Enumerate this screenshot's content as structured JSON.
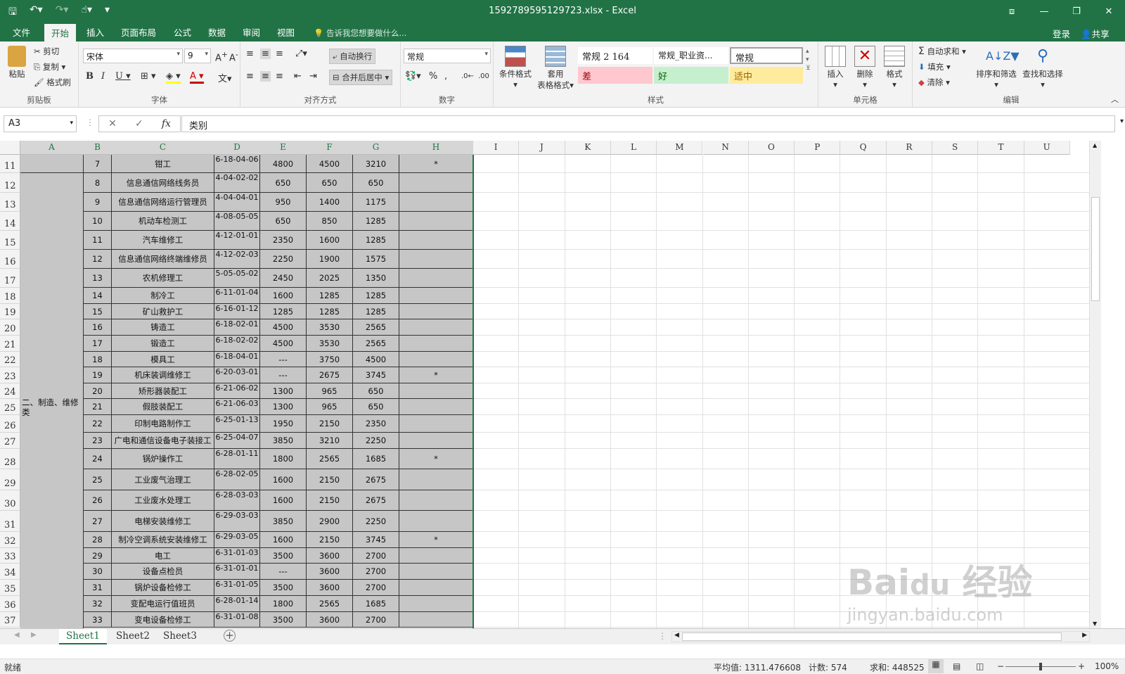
{
  "title": "1592789595129723.xlsx - Excel",
  "tabs": [
    "文件",
    "开始",
    "插入",
    "页面布局",
    "公式",
    "数据",
    "审阅",
    "视图"
  ],
  "tell_me": "告诉我您想要做什么...",
  "signin": "登录",
  "share": "共享",
  "ribbon": {
    "clipboard": {
      "paste": "粘贴",
      "cut": "剪切",
      "copy": "复制",
      "format_painter": "格式刷",
      "label": "剪贴板"
    },
    "font": {
      "name": "宋体",
      "size": "9",
      "label": "字体"
    },
    "align": {
      "wrap": "自动换行",
      "merge": "合并后居中",
      "label": "对齐方式"
    },
    "number": {
      "format": "常规",
      "label": "数字"
    },
    "styles": {
      "cond": "条件格式",
      "table1": "套用",
      "table2": "表格格式",
      "s1": "常规 2 164",
      "s2": "常规_职业资...",
      "s3": "常规",
      "bad": "差",
      "good": "好",
      "neutral": "适中",
      "label": "样式"
    },
    "cells": {
      "insert": "插入",
      "delete": "删除",
      "format": "格式",
      "label": "单元格"
    },
    "editing": {
      "autosum": "自动求和",
      "fill": "填充",
      "clear": "清除",
      "sort": "排序和筛选",
      "find": "查找和选择",
      "label": "编辑"
    }
  },
  "namebox": "A3",
  "formula": "类别",
  "columns": [
    "A",
    "B",
    "C",
    "D",
    "E",
    "F",
    "G",
    "H",
    "I",
    "J",
    "K",
    "L",
    "M",
    "N",
    "O",
    "P",
    "Q",
    "R",
    "S",
    "T",
    "U"
  ],
  "category": "二、制造、维修类",
  "rows": [
    {
      "r": "11",
      "b": "7",
      "c": "钳工",
      "d": "6-18-04-06",
      "e": "4800",
      "f": "4500",
      "g": "3210",
      "h": "*"
    },
    {
      "r": "12",
      "b": "8",
      "c": "信息通信网络线务员",
      "d": "4-04-02-02",
      "e": "650",
      "f": "650",
      "g": "650",
      "h": ""
    },
    {
      "r": "13",
      "b": "9",
      "c": "信息通信网络运行管理员",
      "d": "4-04-04-01",
      "e": "950",
      "f": "1400",
      "g": "1175",
      "h": ""
    },
    {
      "r": "14",
      "b": "10",
      "c": "机动车检测工",
      "d": "4-08-05-05",
      "e": "650",
      "f": "850",
      "g": "1285",
      "h": ""
    },
    {
      "r": "15",
      "b": "11",
      "c": "汽车维修工",
      "d": "4-12-01-01",
      "e": "2350",
      "f": "1600",
      "g": "1285",
      "h": ""
    },
    {
      "r": "16",
      "b": "12",
      "c": "信息通信网络终端维修员",
      "d": "4-12-02-03",
      "e": "2250",
      "f": "1900",
      "g": "1575",
      "h": ""
    },
    {
      "r": "17",
      "b": "13",
      "c": "农机修理工",
      "d": "5-05-05-02",
      "e": "2450",
      "f": "2025",
      "g": "1350",
      "h": ""
    },
    {
      "r": "18",
      "b": "14",
      "c": "制冷工",
      "d": "6-11-01-04",
      "e": "1600",
      "f": "1285",
      "g": "1285",
      "h": ""
    },
    {
      "r": "19",
      "b": "15",
      "c": "矿山救护工",
      "d": "6-16-01-12",
      "e": "1285",
      "f": "1285",
      "g": "1285",
      "h": ""
    },
    {
      "r": "20",
      "b": "16",
      "c": "铸造工",
      "d": "6-18-02-01",
      "e": "4500",
      "f": "3530",
      "g": "2565",
      "h": ""
    },
    {
      "r": "21",
      "b": "17",
      "c": "锻造工",
      "d": "6-18-02-02",
      "e": "4500",
      "f": "3530",
      "g": "2565",
      "h": ""
    },
    {
      "r": "22",
      "b": "18",
      "c": "模具工",
      "d": "6-18-04-01",
      "e": "---",
      "f": "3750",
      "g": "4500",
      "h": ""
    },
    {
      "r": "23",
      "b": "19",
      "c": "机床装调维修工",
      "d": "6-20-03-01",
      "e": "---",
      "f": "2675",
      "g": "3745",
      "h": "*"
    },
    {
      "r": "24",
      "b": "20",
      "c": "矫形器装配工",
      "d": "6-21-06-02",
      "e": "1300",
      "f": "965",
      "g": "650",
      "h": ""
    },
    {
      "r": "25",
      "b": "21",
      "c": "假肢装配工",
      "d": "6-21-06-03",
      "e": "1300",
      "f": "965",
      "g": "650",
      "h": ""
    },
    {
      "r": "26",
      "b": "22",
      "c": "印制电路制作工",
      "d": "6-25-01-13",
      "e": "1950",
      "f": "2150",
      "g": "2350",
      "h": ""
    },
    {
      "r": "27",
      "b": "23",
      "c": "广电和通信设备电子装接工",
      "d": "6-25-04-07",
      "e": "3850",
      "f": "3210",
      "g": "2250",
      "h": ""
    },
    {
      "r": "28",
      "b": "24",
      "c": "锅炉操作工",
      "d": "6-28-01-11",
      "e": "1800",
      "f": "2565",
      "g": "1685",
      "h": "*"
    },
    {
      "r": "29",
      "b": "25",
      "c": "工业废气治理工",
      "d": "6-28-02-05",
      "e": "1600",
      "f": "2150",
      "g": "2675",
      "h": ""
    },
    {
      "r": "30",
      "b": "26",
      "c": "工业废水处理工",
      "d": "6-28-03-03",
      "e": "1600",
      "f": "2150",
      "g": "2675",
      "h": ""
    },
    {
      "r": "31",
      "b": "27",
      "c": "电梯安装维修工",
      "d": "6-29-03-03",
      "e": "3850",
      "f": "2900",
      "g": "2250",
      "h": ""
    },
    {
      "r": "32",
      "b": "28",
      "c": "制冷空调系统安装维修工",
      "d": "6-29-03-05",
      "e": "1600",
      "f": "2150",
      "g": "3745",
      "h": "*"
    },
    {
      "r": "33",
      "b": "29",
      "c": "电工",
      "d": "6-31-01-03",
      "e": "3500",
      "f": "3600",
      "g": "2700",
      "h": ""
    },
    {
      "r": "34",
      "b": "30",
      "c": "设备点检员",
      "d": "6-31-01-01",
      "e": "---",
      "f": "3600",
      "g": "2700",
      "h": ""
    },
    {
      "r": "35",
      "b": "31",
      "c": "锅炉设备检修工",
      "d": "6-31-01-05",
      "e": "3500",
      "f": "3600",
      "g": "2700",
      "h": ""
    },
    {
      "r": "36",
      "b": "32",
      "c": "变配电运行值班员",
      "d": "6-28-01-14",
      "e": "1800",
      "f": "2565",
      "g": "1685",
      "h": ""
    },
    {
      "r": "37",
      "b": "33",
      "c": "变电设备检修工",
      "d": "6-31-01-08",
      "e": "3500",
      "f": "3600",
      "g": "2700",
      "h": ""
    }
  ],
  "sheets": [
    "Sheet1",
    "Sheet2",
    "Sheet3"
  ],
  "status": {
    "ready": "就绪",
    "avg": "平均值: 1311.476608",
    "count": "计数: 574",
    "sum": "求和: 448525",
    "zoom": "100%"
  },
  "watermark": "Bai du 经验 jingyan.baidu.com"
}
